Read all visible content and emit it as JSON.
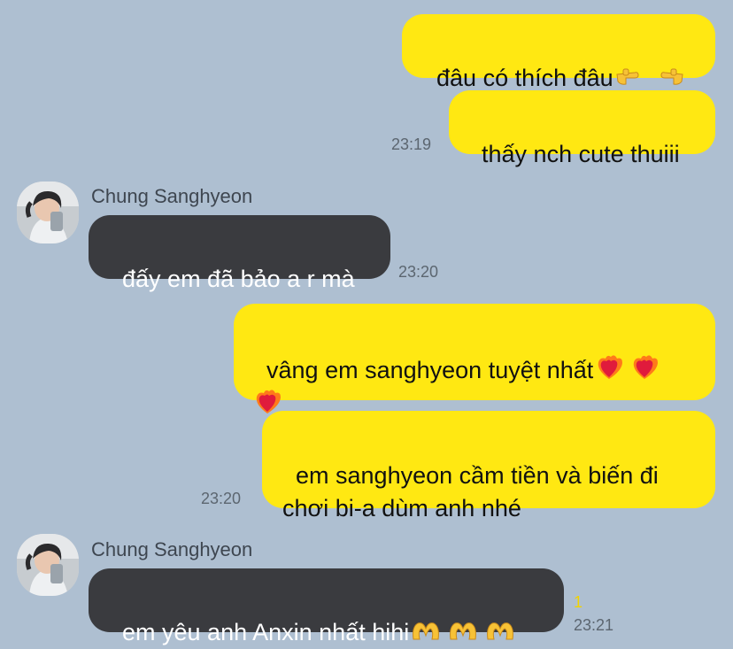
{
  "contact": {
    "name": "Chung Sanghyeon"
  },
  "messages": [
    {
      "text": "đâu có thích đâu",
      "emoji_icon": "pointing-hands-emoji"
    },
    {
      "text": "thấy nch cute thuiii",
      "time": "23:19"
    },
    {
      "text": "đấy em đã bảo a r mà",
      "time": "23:20"
    },
    {
      "text": "vâng em sanghyeon tuyệt nhất",
      "emoji_icon": "heart-on-fire-emoji"
    },
    {
      "text": "em sanghyeon cầm tiền và biến đi\nchơi bi-a dùm anh nhé",
      "time": "23:20"
    },
    {
      "text": "em yêu anh Anxin nhất hihi",
      "emoji_icon": "heart-hands-emoji",
      "unread": "1",
      "time": "23:21"
    }
  ],
  "colors": {
    "background": "#aebfd1",
    "my_bubble": "#ffe812",
    "their_bubble": "#3a3b3f",
    "unread": "#f2d300"
  }
}
